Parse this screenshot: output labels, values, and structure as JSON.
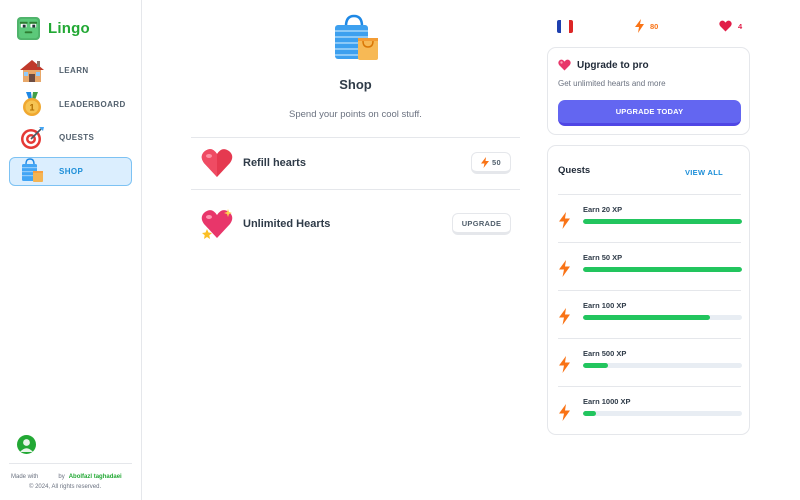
{
  "app": {
    "name": "Lingo"
  },
  "nav": [
    {
      "label": "LEARN",
      "icon": "house-icon",
      "active": false
    },
    {
      "label": "LEADERBOARD",
      "icon": "medal-icon",
      "active": false
    },
    {
      "label": "QUESTS",
      "icon": "target-icon",
      "active": false
    },
    {
      "label": "SHOP",
      "icon": "shopping-bag-icon",
      "active": true
    }
  ],
  "footer": {
    "made_with": "Made with",
    "by": "by",
    "author": "Abolfazl taghadaei",
    "copyright": "© 2024, All rights reserved."
  },
  "page": {
    "title": "Shop",
    "subtitle": "Spend your points on cool stuff."
  },
  "shop_items": [
    {
      "label": "Refill hearts",
      "button": "50",
      "icon": "heart-icon"
    },
    {
      "label": "Unlimited Hearts",
      "button": "UPGRADE",
      "icon": "heart-sparkle-icon"
    }
  ],
  "stats": {
    "language_flag": "france-flag-icon",
    "points": "80",
    "hearts": "4"
  },
  "promo": {
    "title": "Upgrade to pro",
    "text": "Get unlimited hearts and more",
    "button": "UPGRADE TODAY"
  },
  "quests": {
    "title": "Quests",
    "view_all": "VIEW ALL",
    "items": [
      {
        "label": "Earn 20 XP",
        "progress": 1.0
      },
      {
        "label": "Earn 50 XP",
        "progress": 1.0
      },
      {
        "label": "Earn 100 XP",
        "progress": 0.8
      },
      {
        "label": "Earn 500 XP",
        "progress": 0.16
      },
      {
        "label": "Earn 1000 XP",
        "progress": 0.08
      }
    ]
  },
  "colors": {
    "brand_green": "#22a834",
    "accent_blue": "#1c8ed8",
    "upgrade_indigo": "#6366f1",
    "progress_green": "#22c55e",
    "points_orange": "#f97316",
    "hearts_red": "#e11d48"
  }
}
